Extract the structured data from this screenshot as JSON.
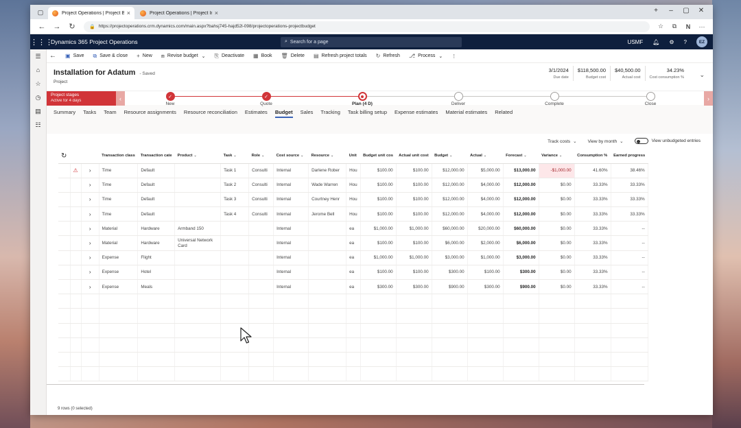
{
  "browser": {
    "tabs": [
      {
        "title": "Project Operations | Project Budg..."
      },
      {
        "title": "Project Operations | Project Invo..."
      }
    ],
    "url": "https://projectoperations.crm.dynamics.com/main.aspx?bahsj745-hajd52l-098/projectoperations-projectbudget"
  },
  "app": {
    "name": "Dynamics 365 Project Operations",
    "search_placeholder": "Search for a page",
    "company": "USMF",
    "user_initials": "EZ"
  },
  "commands": {
    "save": "Save",
    "save_close": "Save & close",
    "new": "New",
    "revise_budget": "Revise budget",
    "deactivate": "Deactivate",
    "book": "Book",
    "delete": "Delete",
    "refresh_totals": "Refresh project totals",
    "refresh": "Refresh",
    "process": "Process"
  },
  "record": {
    "title": "Installation for Adatum",
    "status": "- Saved",
    "entity": "Project",
    "kpis": [
      {
        "value": "3/1/2024",
        "label": "Due date"
      },
      {
        "value": "$118,500.00",
        "label": "Budget cost"
      },
      {
        "value": "$40,500.00",
        "label": "Actual cost"
      },
      {
        "value": "34.23%",
        "label": "Cost consumption %"
      }
    ]
  },
  "process": {
    "box_title": "Project stages",
    "box_sub": "Active for 4 days",
    "stages": [
      "New",
      "Quote",
      "Plan (4 D)",
      "Deliver",
      "Complete",
      "Close"
    ],
    "done_count": 2,
    "active_index": 2
  },
  "form_tabs": [
    "Summary",
    "Tasks",
    "Team",
    "Resource assignments",
    "Resource reconciliation",
    "Estimates",
    "Budget",
    "Sales",
    "Tracking",
    "Task billing setup",
    "Expense estimates",
    "Material estimates",
    "Related"
  ],
  "active_tab": "Budget",
  "grid_tools": {
    "track": "Track costs",
    "view": "View by month",
    "toggle_label": "View unbudgeted entries"
  },
  "grid": {
    "columns": [
      "Transaction class",
      "Transaction cate",
      "Product",
      "Task",
      "Role",
      "Cost source",
      "Resource",
      "Unit",
      "Budget unit cos",
      "Actual unit cost",
      "Budget",
      "Actual",
      "Forecast",
      "Variance",
      "Consumption %",
      "Earned progress"
    ],
    "rows": [
      [
        "Time",
        "Default",
        "",
        "Task 1",
        "Consulti",
        "Internal",
        "Darlene Rober",
        "Hou",
        "$100.00",
        "$100.00",
        "$12,000.00",
        "$5,000.00",
        "$13,000.00",
        "-$1,000.00",
        "41.60%",
        "38.46%"
      ],
      [
        "Time",
        "Default",
        "",
        "Task 2",
        "Consulti",
        "Internal",
        "Wade Warren",
        "Hou",
        "$100.00",
        "$100.00",
        "$12,000.00",
        "$4,000.00",
        "$12,000.00",
        "$0.00",
        "33.33%",
        "33.33%"
      ],
      [
        "Time",
        "Default",
        "",
        "Task 3",
        "Consulti",
        "Internal",
        "Courtney Henr",
        "Hou",
        "$100.00",
        "$100.00",
        "$12,000.00",
        "$4,000.00",
        "$12,000.00",
        "$0.00",
        "33.33%",
        "33.33%"
      ],
      [
        "Time",
        "Default",
        "",
        "Task 4",
        "Consulti",
        "Internal",
        "Jerome Bell",
        "Hou",
        "$100.00",
        "$100.00",
        "$12,000.00",
        "$4,000.00",
        "$12,000.00",
        "$0.00",
        "33.33%",
        "33.33%"
      ],
      [
        "Material",
        "Hardware",
        "Armband 150",
        "",
        "",
        "Internal",
        "",
        "ea",
        "$1,000.00",
        "$1,000.00",
        "$60,000.00",
        "$20,000.00",
        "$60,000.00",
        "$0.00",
        "33.33%",
        "--"
      ],
      [
        "Material",
        "Hardware",
        "Universal Network Card",
        "",
        "",
        "Internal",
        "",
        "ea",
        "$100.00",
        "$100.00",
        "$6,000.00",
        "$2,000.00",
        "$6,000.00",
        "$0.00",
        "33.33%",
        "--"
      ],
      [
        "Expense",
        "Flight",
        "",
        "",
        "",
        "Internal",
        "",
        "ea",
        "$1,000.00",
        "$1,000.00",
        "$3,000.00",
        "$1,000.00",
        "$3,000.00",
        "$0.00",
        "33.33%",
        "--"
      ],
      [
        "Expense",
        "Hotel",
        "",
        "",
        "",
        "Internal",
        "",
        "ea",
        "$100.00",
        "$100.00",
        "$300.00",
        "$100.00",
        "$300.00",
        "$0.00",
        "33.33%",
        "--"
      ],
      [
        "Expense",
        "Meals",
        "",
        "",
        "",
        "Internal",
        "",
        "ea",
        "$300.00",
        "$300.00",
        "$900.00",
        "$300.00",
        "$900.00",
        "$0.00",
        "33.33%",
        "--"
      ]
    ],
    "warning_row": 0,
    "footer": "9 rows (0 selected)"
  }
}
